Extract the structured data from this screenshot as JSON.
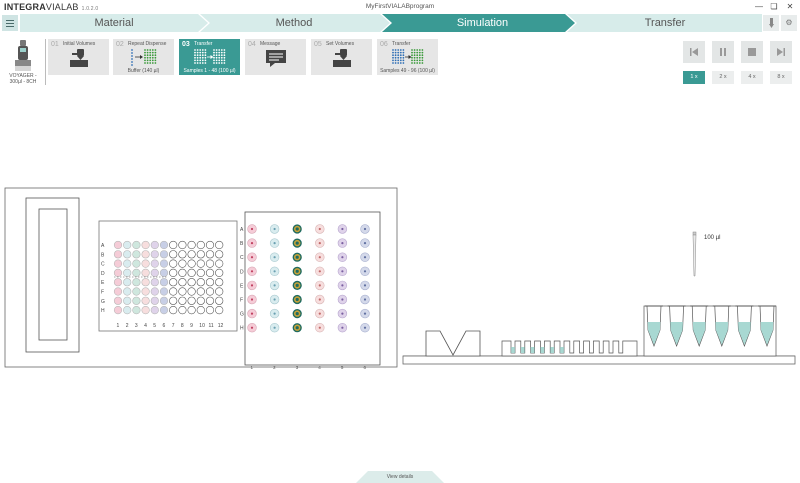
{
  "app": {
    "logo_brand": "INTEGRA",
    "logo_product": "VIALAB",
    "version": "1.0.2.0",
    "window_title": "MyFirstVIALABprogram"
  },
  "nav": {
    "steps": [
      {
        "label": "Material",
        "state": "done"
      },
      {
        "label": "Method",
        "state": "done"
      },
      {
        "label": "Simulation",
        "state": "active"
      },
      {
        "label": "Transfer",
        "state": "todo"
      }
    ],
    "accent_color": "#3a9a94"
  },
  "device": {
    "label_line1": "VOYAGER -",
    "label_line2": "300µl - 8CH",
    "icon": "pipette-icon"
  },
  "program_steps": [
    {
      "num": "01",
      "title": "Initial Volumes",
      "subtitle": "",
      "icon": "pipette-plate-icon",
      "active": false
    },
    {
      "num": "02",
      "title": "Repeat Dispense",
      "subtitle": "Buffer (140 µl)",
      "icon": "repeat-dispense-icon",
      "active": false
    },
    {
      "num": "03",
      "title": "Transfer",
      "subtitle": "Samples 1 - 48 (100 µl)",
      "icon": "transfer-icon",
      "active": true
    },
    {
      "num": "04",
      "title": "Message",
      "subtitle": "",
      "icon": "message-icon",
      "active": false
    },
    {
      "num": "05",
      "title": "Set Volumes",
      "subtitle": "",
      "icon": "pipette-plate-icon",
      "active": false
    },
    {
      "num": "06",
      "title": "Transfer",
      "subtitle": "Samples 49 - 96 (100 µl)",
      "icon": "transfer-icon",
      "active": false
    }
  ],
  "playback": {
    "speeds": [
      "1 x",
      "2 x",
      "4 x",
      "8 x"
    ],
    "active_speed": "1 x"
  },
  "deck": {
    "plate96_rows": [
      "A",
      "B",
      "C",
      "D",
      "E",
      "F",
      "G",
      "H"
    ],
    "plate96_cols": [
      "1",
      "2",
      "3",
      "4",
      "5",
      "6",
      "7",
      "8",
      "9",
      "10",
      "11",
      "12"
    ],
    "plate24_rows": [
      "A",
      "B",
      "C",
      "D",
      "E",
      "F",
      "G",
      "H"
    ],
    "plate24_cols": [
      "1",
      "2",
      "3",
      "4",
      "5",
      "6"
    ],
    "tip_volume": "100 µl"
  },
  "footer": {
    "view_details": "View details"
  }
}
